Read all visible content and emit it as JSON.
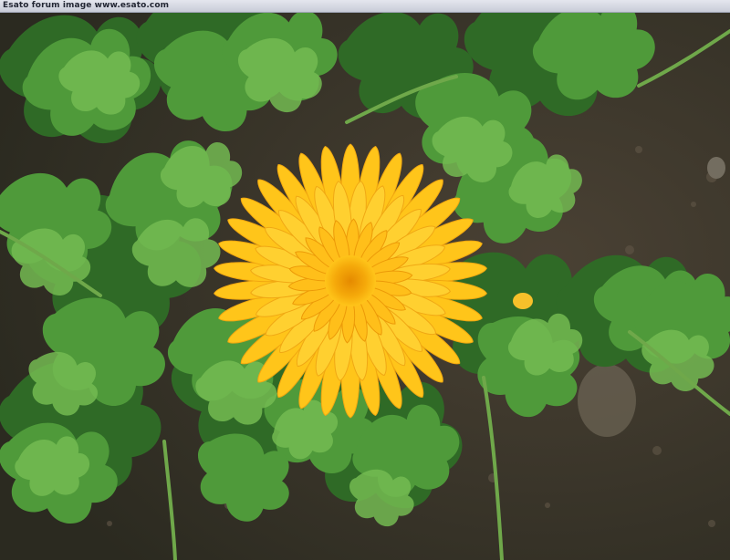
{
  "banner": {
    "text": "Esato forum image www.esato.com"
  },
  "photo": {
    "subject": "flower-photo",
    "colors": {
      "petal": "#ffc51a",
      "petal_light": "#ffe04a",
      "center": "#f0a000",
      "foliage": "#4f9a3a",
      "foliage_light": "#74bb52",
      "soil": "#3b3528"
    }
  }
}
